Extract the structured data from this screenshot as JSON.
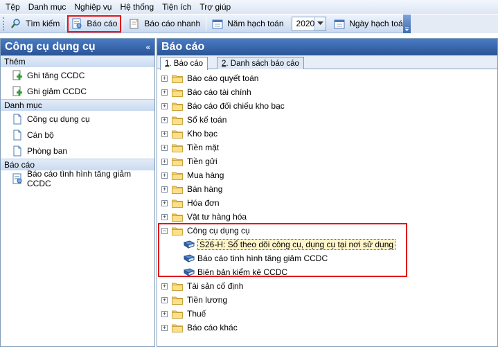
{
  "menu": [
    "Tệp",
    "Danh mục",
    "Nghiệp vụ",
    "Hệ thống",
    "Tiện ích",
    "Trợ giúp"
  ],
  "toolbar": {
    "search": "Tìm kiếm",
    "report": "Báo cáo",
    "quick_report": "Báo cáo nhanh",
    "fiscal_year_label": "Năm hạch toán",
    "fiscal_year_value": "2020",
    "posting_date": "Ngày hạch toán"
  },
  "left_panel": {
    "title": "Công cụ dụng cụ",
    "sections": [
      {
        "label": "Thêm",
        "items": [
          "Ghi tăng CCDC",
          "Ghi giảm CCDC"
        ]
      },
      {
        "label": "Danh mục",
        "items": [
          "Công cụ dụng cụ",
          "Cán bộ",
          "Phòng ban"
        ]
      },
      {
        "label": "Báo cáo",
        "items": [
          "Báo cáo tình hình tăng giảm CCDC"
        ]
      }
    ]
  },
  "right_panel": {
    "title": "Báo cáo",
    "tabs": [
      {
        "num": "1",
        "label": ". Báo cáo"
      },
      {
        "num": "2",
        "label": ". Danh sách báo cáo"
      }
    ],
    "tree": [
      "Báo cáo quyết toán",
      "Báo cáo tài chính",
      "Báo cáo đối chiếu kho bạc",
      "Sổ kế toán",
      "Kho bạc",
      "Tiền mặt",
      "Tiền gửi",
      "Mua hàng",
      "Bán hàng",
      "Hóa đơn",
      "Vật tư hàng hóa",
      "Công cụ dụng cụ",
      "Tài sản cố định",
      "Tiền lương",
      "Thuế",
      "Báo cáo khác"
    ],
    "ccdc_children": [
      "S26-H: Sổ theo dõi công cụ, dụng cụ tại nơi sử dụng",
      "Báo cáo tình hình tăng giảm CCDC",
      "Biên bản kiểm kê CCDC"
    ]
  }
}
